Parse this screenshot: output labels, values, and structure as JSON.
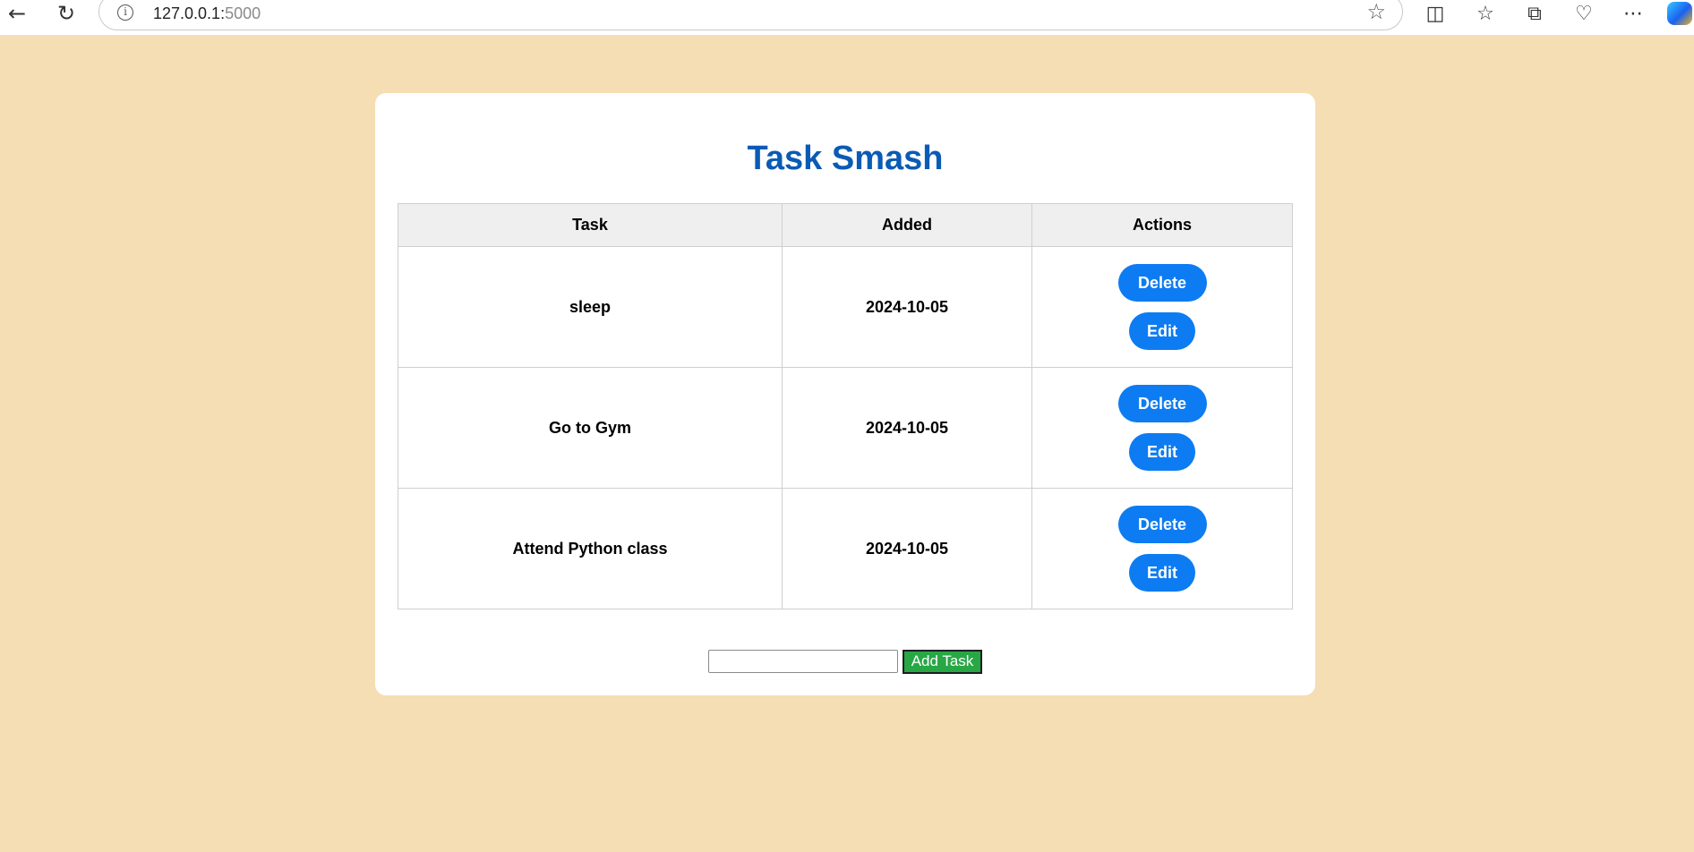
{
  "browser": {
    "url_host": "127.0.0.1:",
    "url_port": "5000",
    "icons": {
      "back": "back-arrow-icon",
      "reload": "reload-icon",
      "info": "site-info-icon",
      "favorite": "star-icon",
      "split": "split-screen-icon",
      "favorites": "favorites-icon",
      "collections": "collections-icon",
      "health": "browser-essentials-icon",
      "more": "more-icon",
      "copilot": "copilot-icon"
    }
  },
  "app": {
    "title": "Task Smash",
    "colors": {
      "background": "#f5deb3",
      "title": "#0a5bb5",
      "action_button": "#0d7cf2",
      "add_button": "#28a745"
    }
  },
  "table": {
    "headers": [
      "Task",
      "Added",
      "Actions"
    ],
    "rows": [
      {
        "task": "sleep",
        "added": "2024-10-05",
        "delete_label": "Delete",
        "edit_label": "Edit"
      },
      {
        "task": "Go to Gym",
        "added": "2024-10-05",
        "delete_label": "Delete",
        "edit_label": "Edit"
      },
      {
        "task": "Attend Python class",
        "added": "2024-10-05",
        "delete_label": "Delete",
        "edit_label": "Edit"
      }
    ]
  },
  "add_form": {
    "input_value": "",
    "button_label": "Add Task"
  }
}
